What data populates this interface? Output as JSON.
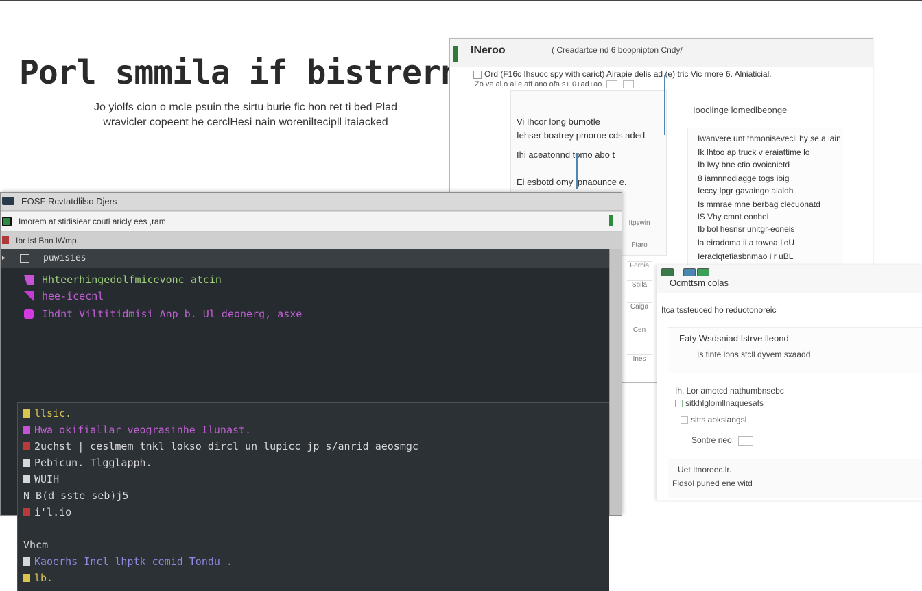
{
  "hero": {
    "title": "Porl smmila if bistrern",
    "subtitle_line1": "Jo yiolfs cion o mcle psuin  the sirtu burie fic hon ret ti bed Plad",
    "subtitle_line2": "wravicler copeent he cerclHesi nain woreniltecipll itaiacked"
  },
  "back_window": {
    "brand": "INeroo",
    "heading": "( Creadartce nd 6 boopnipton Cndy/",
    "bar_text": "Ord (F16c  Ihsuoc spy with carict) Airapie delis ad (e) tric Vic rnore 6. Alniaticial.",
    "row2_text": "Zo ve al o al e aff ano ofa  s+  0+ad+ao",
    "left_items": [
      "Vi Ihcor long bumotle",
      "Iehser boatrey pmorne cds aded",
      "Ihi aceatonnd tomo abo t",
      "Ei esbotd omy ipnaounce e."
    ],
    "right_title": "Iooclinge lomedlbeonge",
    "right_items": [
      "Iwanvere unt thmonisevecli hy se a lain",
      "Ik Ihtoo ap truck v eraiattime lo",
      "Ib Iwy bne ctio ovoicnietd",
      "8 iamnnodiagge togs ibig",
      "Ieccy Ipgr gavaingo alaldh",
      "Is mmrae mne berbag clecuonatd",
      "lS Vhy cmnt eonhel",
      "Ib bol hesnsr unitgr-eoneis",
      "la eiradoma ii a towoa I'oU",
      "Ieraclqtefiasbnmao i r uBL"
    ],
    "side_labels": [
      "Itpswin",
      "Ftaro",
      "Ferbis",
      "Sbila",
      "Caiga",
      "Cen",
      "Ines"
    ]
  },
  "front_window": {
    "title": "Ocmttsm colas",
    "subtitle": "Itca tssteuced ho reduotonoreic",
    "card_title": "Faty Wsdsniad Istrve lleond",
    "card_sub": "Is tinte lons stcll dyvem sxaadd",
    "item1": "Ih. Lor amotcd nathumbnsebc",
    "item2": "sitkhlglomllnaquesats",
    "item3": "sitts aoksiangsl",
    "item4": "Sontre neo:",
    "bottom1": "Uet Itnoreec.lr.",
    "bottom2": "Fidsol puned ene witd"
  },
  "terminal": {
    "title": "EOSF Rcvtatdlilso Djers",
    "toolbar_text": "Imorem  at stidisiear coutl aricly ees   ,ram",
    "menu_text": "Ibr Isf Bnn  lWmp,",
    "pane_header": "puwisies",
    "console_lines": [
      {
        "text": "Hhteerhingedolfmicevonc atcin",
        "color": "#9fd27a",
        "glyph": "#c653d6"
      },
      {
        "text": "hee-icecnl",
        "color": "#c05fd2",
        "glyph": "#c63ad6"
      },
      {
        "text": "Ihdnt Viltitidmisi Anp b.  Ul deonerg, asxe",
        "color": "#c05fd2",
        "glyph": "#d33ae0"
      }
    ],
    "editor_lines": [
      {
        "text": "llsic.",
        "color": "#d9c44e",
        "mark": "#d9c44e"
      },
      {
        "text": "Hwa okifiallar veograsinhe Ilunast.",
        "color": "#c05fd2",
        "mark": "#c653d6"
      },
      {
        "text": "2uchst   | ceslmem tnkl lokso dircl un lupicc  jp s/anrid aeosmgc",
        "color": "#d7d7d7",
        "mark": "#b83a3a"
      },
      {
        "text": "Pebicun.  Tlgglapph.",
        "color": "#d7d7d7",
        "mark": "#d7d7d7"
      },
      {
        "text": "WUIH",
        "color": "#d7d7d7",
        "mark": "#d7d7d7"
      },
      {
        "text": "N B(d sste seb)j5",
        "color": "#d7d7d7",
        "mark": ""
      },
      {
        "text": "i'l.io",
        "color": "#d7d7d7",
        "mark": "#b83a3a"
      },
      {
        "text": "",
        "color": "#d7d7d7",
        "mark": ""
      },
      {
        "text": "Vhcm",
        "color": "#d7d7d7",
        "mark": ""
      },
      {
        "text": "Kaoerhs Incl lhptk cemid Tondu .",
        "color": "#8f88e0",
        "mark": "#d7d7d7"
      },
      {
        "text": "lb.",
        "color": "#d9c44e",
        "mark": "#d9c44e"
      }
    ]
  }
}
